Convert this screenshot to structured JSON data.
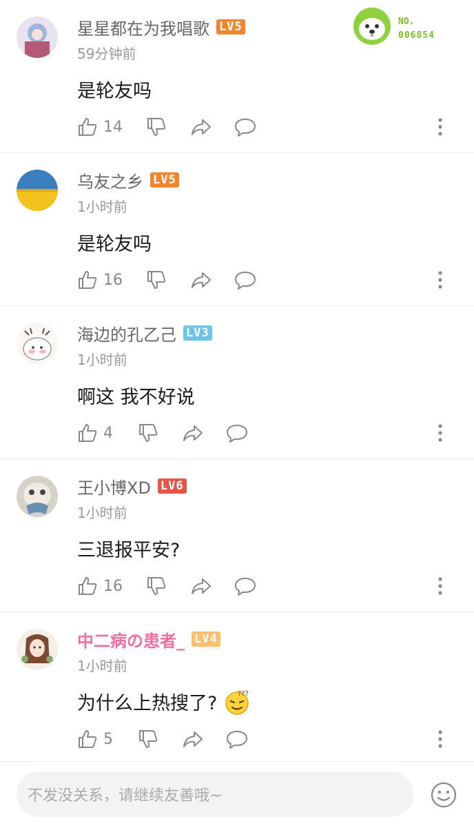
{
  "comments": [
    {
      "username": "星星都在为我唱歌",
      "level": "LV5",
      "level_color": "#f2862b",
      "time": "59分钟前",
      "text": "是轮友吗",
      "likes": "14",
      "medal": {
        "prefix": "NO.",
        "number": "006854"
      }
    },
    {
      "username": "乌友之乡",
      "level": "LV5",
      "level_color": "#f2862b",
      "time": "1小时前",
      "text": "是轮友吗",
      "likes": "16"
    },
    {
      "username": "海边的孔乙己",
      "level": "LV3",
      "level_color": "#6cc4e8",
      "time": "1小时前",
      "text": "啊这 我不好说",
      "likes": "4"
    },
    {
      "username": "王小博XD",
      "level": "LV6",
      "level_color": "#e8534a",
      "time": "1小时前",
      "text": "三退报平安?",
      "likes": "16"
    },
    {
      "username": "中二病の患者_",
      "username_color": "#f06f9f",
      "level": "LV4",
      "level_color": "#fcbf6f",
      "time": "1小时前",
      "text": "为什么上热搜了?",
      "likes": "5",
      "emoji": "confused-smile-emoji"
    }
  ],
  "icons": [
    "like-icon",
    "dislike-icon",
    "share-icon",
    "reply-icon",
    "more-icon",
    "emoji-icon"
  ],
  "composer": {
    "placeholder": "不发没关系，请继续友善哦~"
  }
}
